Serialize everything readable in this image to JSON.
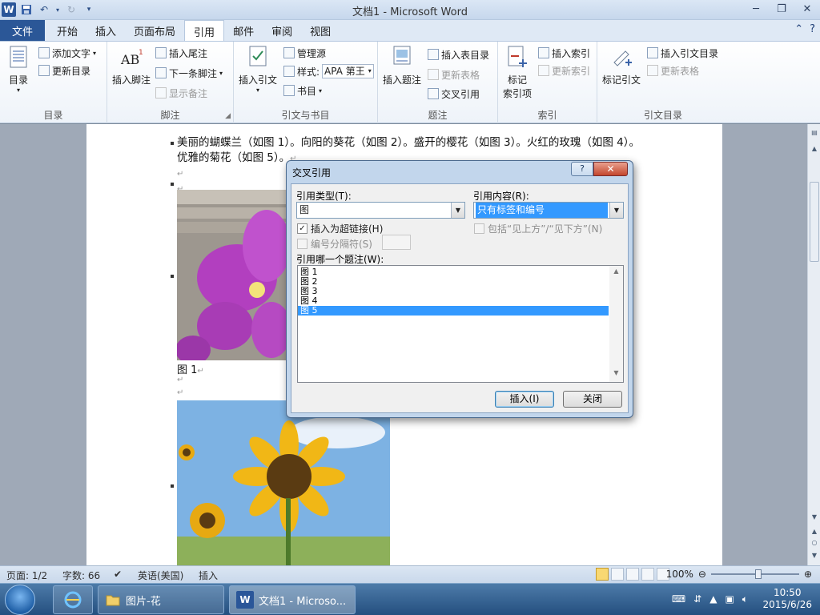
{
  "window": {
    "title": "文档1  -  Microsoft Word",
    "qat": [
      "word-logo",
      "save-icon",
      "undo-icon",
      "redo-icon",
      "customize-icon"
    ],
    "controls": [
      "minimize-icon",
      "restore-icon",
      "close-icon"
    ]
  },
  "tabs": {
    "file": "文件",
    "items": [
      "开始",
      "插入",
      "页面布局",
      "引用",
      "邮件",
      "审阅",
      "视图"
    ],
    "active": "引用"
  },
  "ribbon": {
    "toc": {
      "big": "目录",
      "add_text": "添加文字",
      "update": "更新目录",
      "label": "目录"
    },
    "footnotes": {
      "insert_footnote": "插入脚注",
      "insert_endnote": "插入尾注",
      "next_footnote": "下一条脚注",
      "show_notes": "显示备注",
      "label": "脚注",
      "ab_glyph": "AB",
      "ab_sup": "1"
    },
    "citations": {
      "insert_citation": "插入引文",
      "manage_sources": "管理源",
      "style_label": "样式:",
      "style_value": "APA 第王",
      "bibliography": "书目",
      "label": "引文与书目"
    },
    "captions": {
      "insert_caption": "插入题注",
      "insert_table_of_figures": "插入表目录",
      "update_table": "更新表格",
      "cross_reference": "交叉引用",
      "label": "题注"
    },
    "index": {
      "mark_entry_1": "标记",
      "mark_entry_2": "索引项",
      "insert_index": "插入索引",
      "update_index": "更新索引",
      "label": "索引"
    },
    "toa": {
      "mark_citation": "标记引文",
      "insert_toa": "插入引文目录",
      "update_table": "更新表格",
      "label": "引文目录"
    }
  },
  "document": {
    "line1": "美丽的蝴蝶兰（如图 1）。向阳的葵花（如图 2）。盛开的樱花（如图 3）。火红的玫瑰（如图 4）。",
    "line2": "优雅的菊花（如图 5）。",
    "return_mark": "↵",
    "caption1": "图 1"
  },
  "dialog": {
    "title": "交叉引用",
    "ref_type_label": "引用类型(T):",
    "ref_type_value": "图",
    "ref_content_label": "引用内容(R):",
    "ref_content_value": "只有标签和编号",
    "insert_hyperlink": "插入为超链接(H)",
    "include_above_below": "包括“见上方”/“见下方”(N)",
    "separate_numbers": "编号分隔符(S)",
    "which_caption_label": "引用哪一个题注(W):",
    "captions": [
      "图 1",
      "图 2",
      "图 3",
      "图 4",
      "图 5"
    ],
    "selected_index": 4,
    "insert_button": "插入(I)",
    "close_button": "关闭"
  },
  "statusbar": {
    "page": "页面: 1/2",
    "words": "字数: 66",
    "language": "英语(美国)",
    "mode": "插入",
    "zoom": "100%"
  },
  "taskbar": {
    "folder_task": "图片-花",
    "word_task": "文档1 - Microso...",
    "time": "10:50",
    "date": "2015/6/26"
  },
  "colors": {
    "accent": "#2b5797",
    "selection": "#3399ff"
  }
}
